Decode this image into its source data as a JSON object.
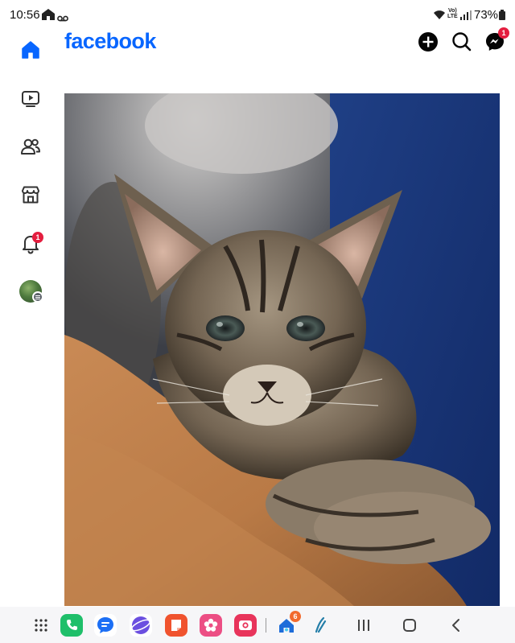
{
  "status_bar": {
    "time": "10:56",
    "volte_line1": "Vo)",
    "volte_line2": "LTE",
    "battery": "73%"
  },
  "header": {
    "logo": "facebook",
    "messenger_badge": "1",
    "brand_color": "#0866ff"
  },
  "nav": {
    "items": [
      {
        "name": "home",
        "icon": "home-icon",
        "active": true
      },
      {
        "name": "video",
        "icon": "video-icon"
      },
      {
        "name": "friends",
        "icon": "friends-icon"
      },
      {
        "name": "marketplace",
        "icon": "marketplace-icon"
      },
      {
        "name": "notifications",
        "icon": "bell-icon",
        "badge": "1"
      },
      {
        "name": "profile",
        "icon": "avatar"
      }
    ]
  },
  "post": {
    "image": "tabby-kitten-photo"
  },
  "taskbar": {
    "apps": [
      "apps-grid-icon",
      "phone",
      "messages",
      "internet",
      "notes",
      "gallery",
      "camera",
      "smartthings",
      "recent-app"
    ],
    "recent_badge": "6"
  }
}
